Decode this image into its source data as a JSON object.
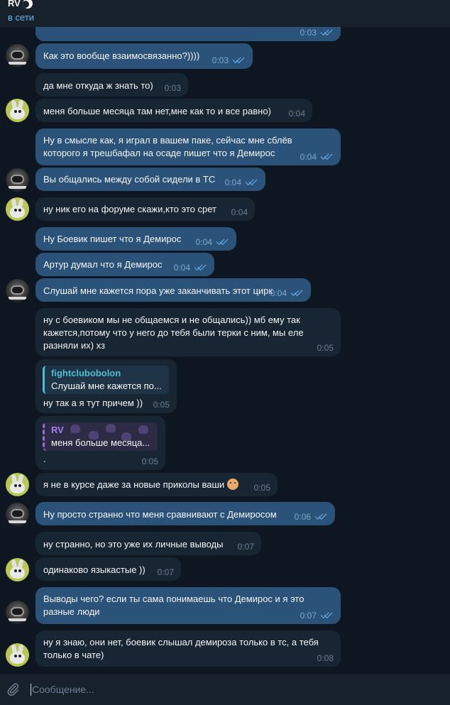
{
  "header": {
    "name": "RV",
    "status": "в сети"
  },
  "composer": {
    "placeholder": "Сообщение..."
  },
  "messages": [
    {
      "time": "0:03"
    },
    {
      "text": "Как это вообще взаимосвязанно?))))",
      "time": "0:03"
    },
    {
      "text": "да мне откуда ж знать то)",
      "time": "0:03"
    },
    {
      "text": "меня больше месяца там нет,мне как то и  все равно)",
      "time": "0:04"
    },
    {
      "line1": "Ну в смысле как, я играл в вашем паке, сейчас мне сблёв",
      "line2": "которого я трешбафал на осаде пишет что я Демирос",
      "time": "0:04"
    },
    {
      "text": "Вы общались между собой сидели в ТС",
      "time": "0:04"
    },
    {
      "text": "ну ник его на форуме скажи,кто это срет",
      "time": "0:04"
    },
    {
      "text": "Ну Боевик пишет что я Демирос",
      "time": "0:04"
    },
    {
      "text": "Артур думал что я Демирос",
      "time": "0:04"
    },
    {
      "text": "Слушай мне кажется пора уже заканчивать этот цирк",
      "time": "0:04"
    },
    {
      "line1": "ну с боевиком мы не общаемся и не общались)) мб ему так",
      "line2": "кажется,потому что у него до тебя были терки с ним, мы еле",
      "line3": "разняли их) хз",
      "time": "0:05"
    },
    {
      "reply_name": "fightclubobolon",
      "reply_text": "Слушай мне кажется по...",
      "text": "ну так а я тут причем ))",
      "time": "0:05"
    },
    {
      "reply_name": "RV",
      "reply_text": "меня больше месяца...",
      "text": ".",
      "time": "0:05"
    },
    {
      "text": "я не в курсе даже за новые приколы ваши",
      "time": "0:05"
    },
    {
      "text": "Ну просто странно что меня сравнивают с Демиросом",
      "time": "0:06"
    },
    {
      "text": "ну странно, но это уже их личные выводы",
      "time": "0:07"
    },
    {
      "text": "одинаково языкастые ))",
      "time": "0:07"
    },
    {
      "line1": "Выводы чего? если ты сама понимаешь что Демирос и я это",
      "line2": "разные люди",
      "time": "0:07"
    },
    {
      "line1": "ну я знаю, они нет, боевик слышал демироза только в тс, а тебя",
      "line2": "только в чате)",
      "time": "0:08"
    }
  ]
}
